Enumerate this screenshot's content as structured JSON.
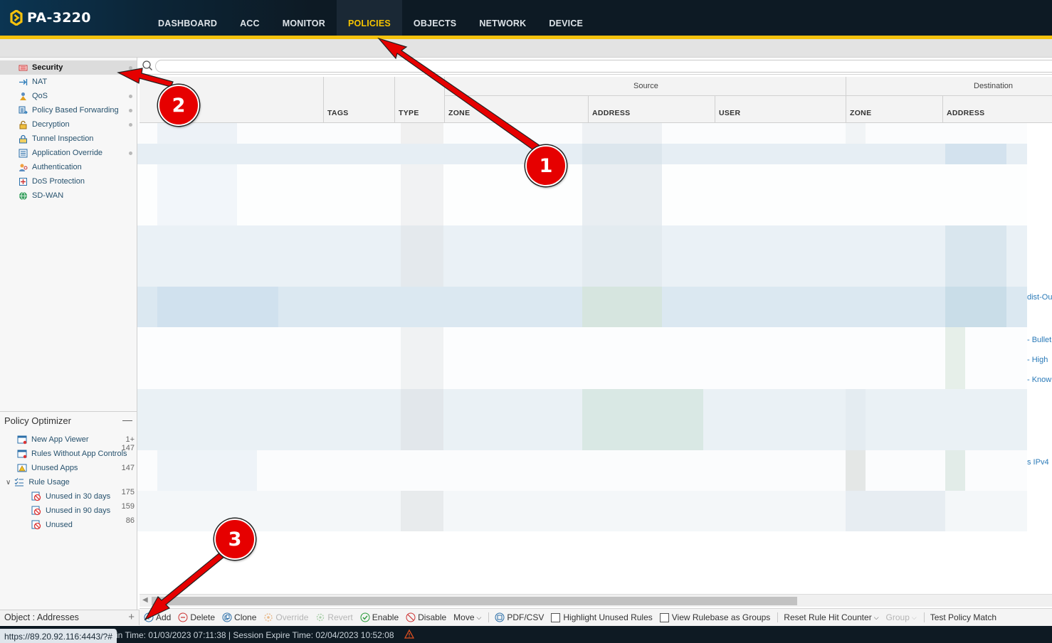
{
  "app": {
    "device_name": "PA-3220",
    "brand_color": "#f4c20d"
  },
  "nav": {
    "items": [
      "DASHBOARD",
      "ACC",
      "MONITOR",
      "POLICIES",
      "OBJECTS",
      "NETWORK",
      "DEVICE"
    ],
    "active": "POLICIES"
  },
  "policies_tree": {
    "items": [
      {
        "label": "Security",
        "icon": "security-policy-icon",
        "selected": true,
        "dot": true
      },
      {
        "label": "NAT",
        "icon": "nat-icon",
        "selected": false,
        "dot": false
      },
      {
        "label": "QoS",
        "icon": "qos-icon",
        "selected": false,
        "dot": true
      },
      {
        "label": "Policy Based Forwarding",
        "icon": "pbf-icon",
        "selected": false,
        "dot": true
      },
      {
        "label": "Decryption",
        "icon": "decryption-icon",
        "selected": false,
        "dot": true
      },
      {
        "label": "Tunnel Inspection",
        "icon": "tunnel-icon",
        "selected": false,
        "dot": false
      },
      {
        "label": "Application Override",
        "icon": "app-override-icon",
        "selected": false,
        "dot": true
      },
      {
        "label": "Authentication",
        "icon": "authentication-icon",
        "selected": false,
        "dot": false
      },
      {
        "label": "DoS Protection",
        "icon": "dos-icon",
        "selected": false,
        "dot": false
      },
      {
        "label": "SD-WAN",
        "icon": "sdwan-icon",
        "selected": false,
        "dot": false
      }
    ]
  },
  "policy_optimizer": {
    "title": "Policy Optimizer",
    "collapse": "—",
    "items": [
      {
        "label": "New App Viewer",
        "count": "1+",
        "indent": 0
      },
      {
        "label": "Rules Without App Controls",
        "count": "147",
        "indent": 0
      },
      {
        "label": "Unused Apps",
        "count": "147",
        "indent": 0
      },
      {
        "label": "Rule Usage",
        "count": "",
        "indent": 0,
        "expandable": true
      },
      {
        "label": "Unused in 30 days",
        "count": "175",
        "indent": 1
      },
      {
        "label": "Unused in 90 days",
        "count": "159",
        "indent": 1
      },
      {
        "label": "Unused",
        "count": "86",
        "indent": 1
      }
    ]
  },
  "objects_bar": {
    "label": "Object : Addresses",
    "add": "+"
  },
  "search": {
    "placeholder": "",
    "value": ""
  },
  "table": {
    "group_headers": {
      "source": "Source",
      "destination": "Destination"
    },
    "columns": [
      "TAGS",
      "TYPE",
      "ZONE",
      "ADDRESS",
      "USER",
      "ZONE",
      "ADDRESS"
    ],
    "visible_fragments": [
      "dist-Ou",
      "- Bullet",
      "- High",
      "- Know",
      "s IPv4"
    ]
  },
  "toolbar": {
    "add": "Add",
    "delete": "Delete",
    "clone": "Clone",
    "override": "Override",
    "revert": "Revert",
    "enable": "Enable",
    "disable": "Disable",
    "move": "Move",
    "pdf_csv": "PDF/CSV",
    "highlight_unused": "Highlight Unused Rules",
    "view_groups": "View Rulebase as Groups",
    "reset_counter": "Reset Rule Hit Counter",
    "group": "Group",
    "test_policy": "Test Policy Match"
  },
  "status": {
    "url": "https://89.20.92.116:4443/?#",
    "info": "in Time: 01/03/2023 07:11:38 | Session Expire Time: 02/04/2023 10:52:08"
  },
  "annotations": {
    "badges": [
      "1",
      "2",
      "3"
    ],
    "color": "#e60000"
  }
}
